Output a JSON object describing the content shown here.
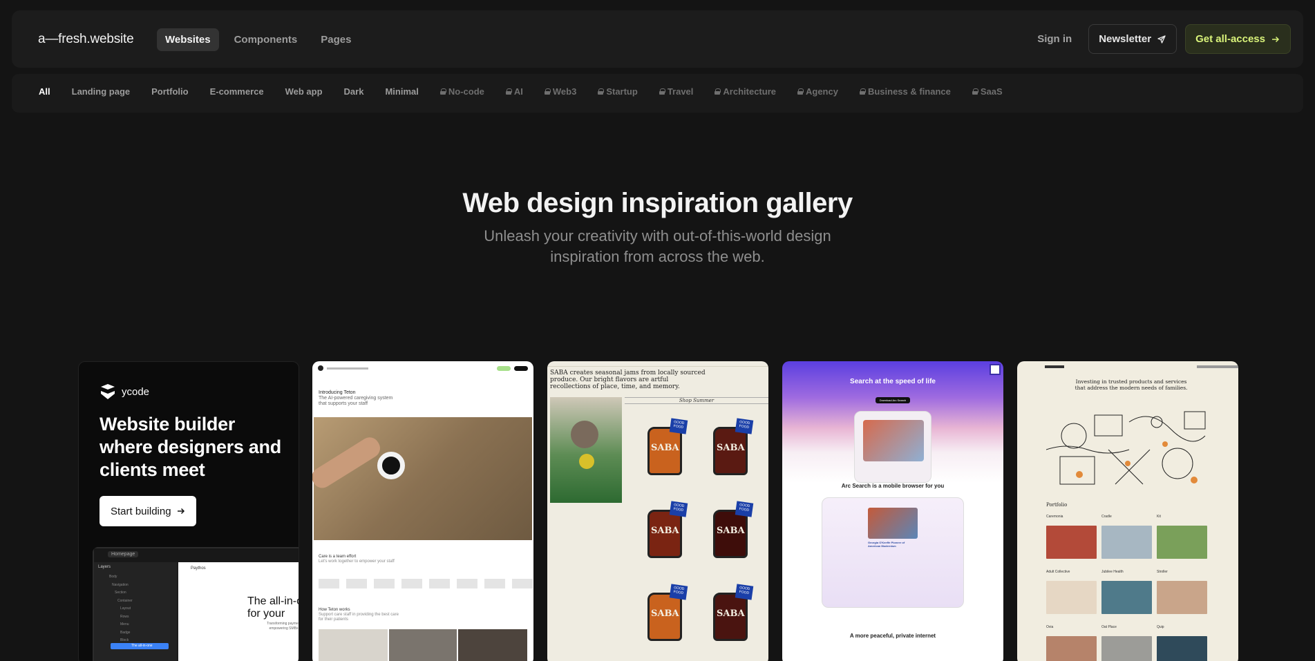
{
  "header": {
    "brand": "a—fresh.website",
    "nav": [
      {
        "label": "Websites",
        "active": true
      },
      {
        "label": "Components",
        "active": false
      },
      {
        "label": "Pages",
        "active": false
      }
    ],
    "sign_in": "Sign in",
    "newsletter": "Newsletter",
    "get_access": "Get all-access",
    "accent_color": "#d9f37a"
  },
  "filters": [
    {
      "label": "All",
      "active": true,
      "locked": false
    },
    {
      "label": "Landing page",
      "locked": false
    },
    {
      "label": "Portfolio",
      "locked": false
    },
    {
      "label": "E-commerce",
      "locked": false
    },
    {
      "label": "Web app",
      "locked": false
    },
    {
      "label": "Dark",
      "locked": false
    },
    {
      "label": "Minimal",
      "locked": false
    },
    {
      "label": "No-code",
      "locked": true
    },
    {
      "label": "AI",
      "locked": true
    },
    {
      "label": "Web3",
      "locked": true
    },
    {
      "label": "Startup",
      "locked": true
    },
    {
      "label": "Travel",
      "locked": true
    },
    {
      "label": "Architecture",
      "locked": true
    },
    {
      "label": "Agency",
      "locked": true
    },
    {
      "label": "Business & finance",
      "locked": true
    },
    {
      "label": "SaaS",
      "locked": true
    }
  ],
  "hero": {
    "title": "Web design inspiration gallery",
    "subtitle": "Unleash your creativity with out-of-this-world design inspiration from across the web."
  },
  "cards": {
    "ycode": {
      "logo": "ycode",
      "title": "Website builder where designers and clients meet",
      "cta": "Start building",
      "app_tab": "Homepage",
      "layers_label": "Layers",
      "layers": [
        "Body",
        "Navigation",
        "Section",
        "Container",
        "Layout",
        "Rows",
        "Menu",
        "Badge",
        "Block"
      ],
      "selected_layer": "The all-in-one",
      "canvas_brand": "Paythos",
      "canvas_headline": "The all-in-one for your",
      "canvas_sub": "Transforming payments, empowering SMBs w"
    },
    "teton": {
      "headline": "Introducing Teton",
      "sub": "The AI-powered caregiving system that supports your staff",
      "section1_title": "Care is a team effort",
      "section1_sub": "Let's work together to empower your staff",
      "section2_title": "How Teton works",
      "section2_sub": "Support care staff in providing the best care for their patients"
    },
    "saba": {
      "headline": "SABA creates seasonal jams from locally sourced produce. Our bright flavors are artful recollections of place, time, and memory.",
      "shop_label": "Shop Summer",
      "jar_label": "SABA",
      "badge": "GOOD FOOD"
    },
    "arc": {
      "title": "Search at the speed of life",
      "download": "Download Arc Search",
      "mid": "Arc Search is a mobile browser for you",
      "foot": "A more peaceful, private internet",
      "result_title": "Georgia O'Keeffe Pioneer of American Modernism"
    },
    "blackbox": {
      "headline": "Investing in trusted products and services that address the modern needs of families.",
      "portfolio_label": "Portfolio",
      "items": [
        "Caremonia",
        "Cradle",
        "Kit",
        "Adult Collective",
        "Jubilee Health",
        "Stroller",
        "Ovia",
        "Oat Place",
        "Quip"
      ]
    }
  }
}
